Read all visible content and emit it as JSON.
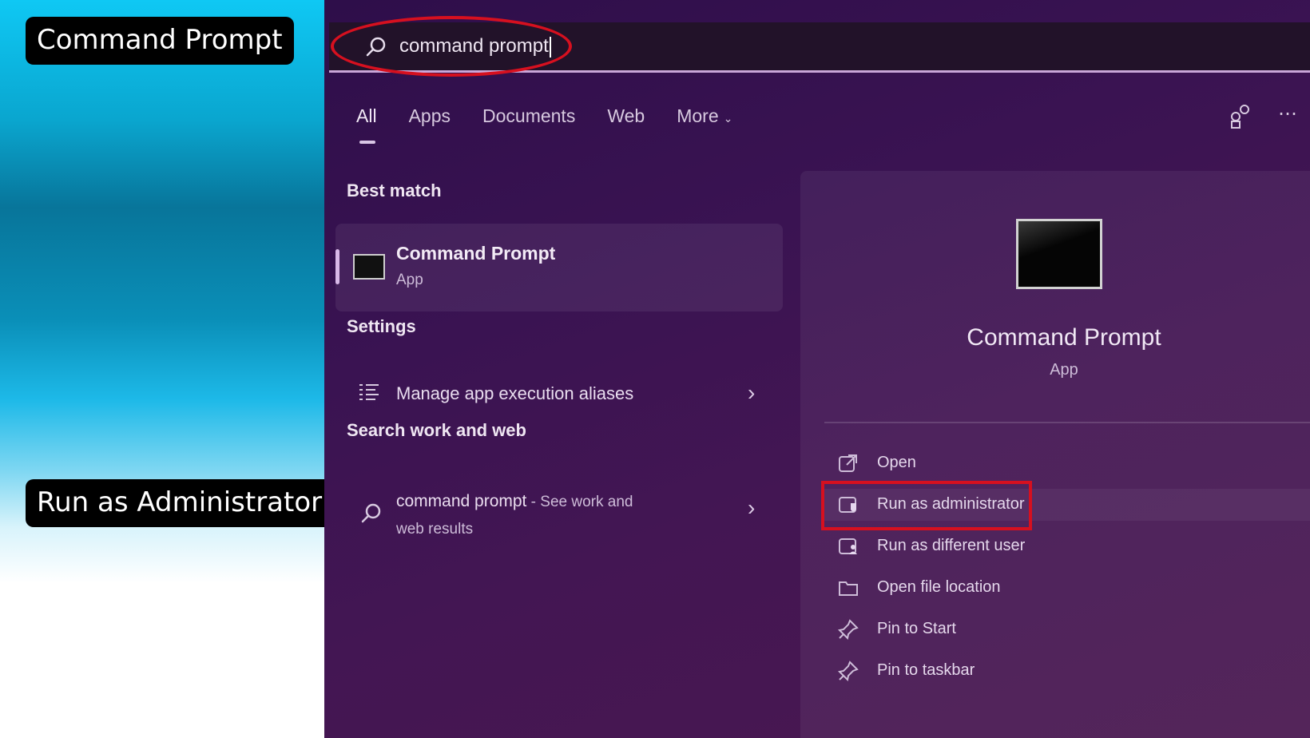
{
  "callouts": {
    "step1": "Command Prompt",
    "step2": "Run as Administrator"
  },
  "search": {
    "query": "command prompt"
  },
  "tabs": [
    {
      "label": "All"
    },
    {
      "label": "Apps"
    },
    {
      "label": "Documents"
    },
    {
      "label": "Web"
    },
    {
      "label": "More"
    }
  ],
  "sections": {
    "best_match": "Best match",
    "settings": "Settings",
    "search_web": "Search work and web"
  },
  "best_match_item": {
    "title": "Command Prompt",
    "subtitle": "App"
  },
  "settings_item": {
    "label": "Manage app execution aliases"
  },
  "web_item": {
    "query": "command prompt",
    "suffix": " - See work and",
    "line2": "web results"
  },
  "detail_pane": {
    "title": "Command Prompt",
    "subtitle": "App",
    "actions": [
      {
        "label": "Open",
        "icon": "open-icon"
      },
      {
        "label": "Run as administrator",
        "icon": "shield-app-icon"
      },
      {
        "label": "Run as different user",
        "icon": "user-app-icon"
      },
      {
        "label": "Open file location",
        "icon": "folder-icon"
      },
      {
        "label": "Pin to Start",
        "icon": "pin-icon"
      },
      {
        "label": "Pin to taskbar",
        "icon": "pin-icon"
      }
    ]
  },
  "colors": {
    "highlight": "#d6101f",
    "callout_bg": "#000000",
    "panel_bg": "#3a1352"
  }
}
